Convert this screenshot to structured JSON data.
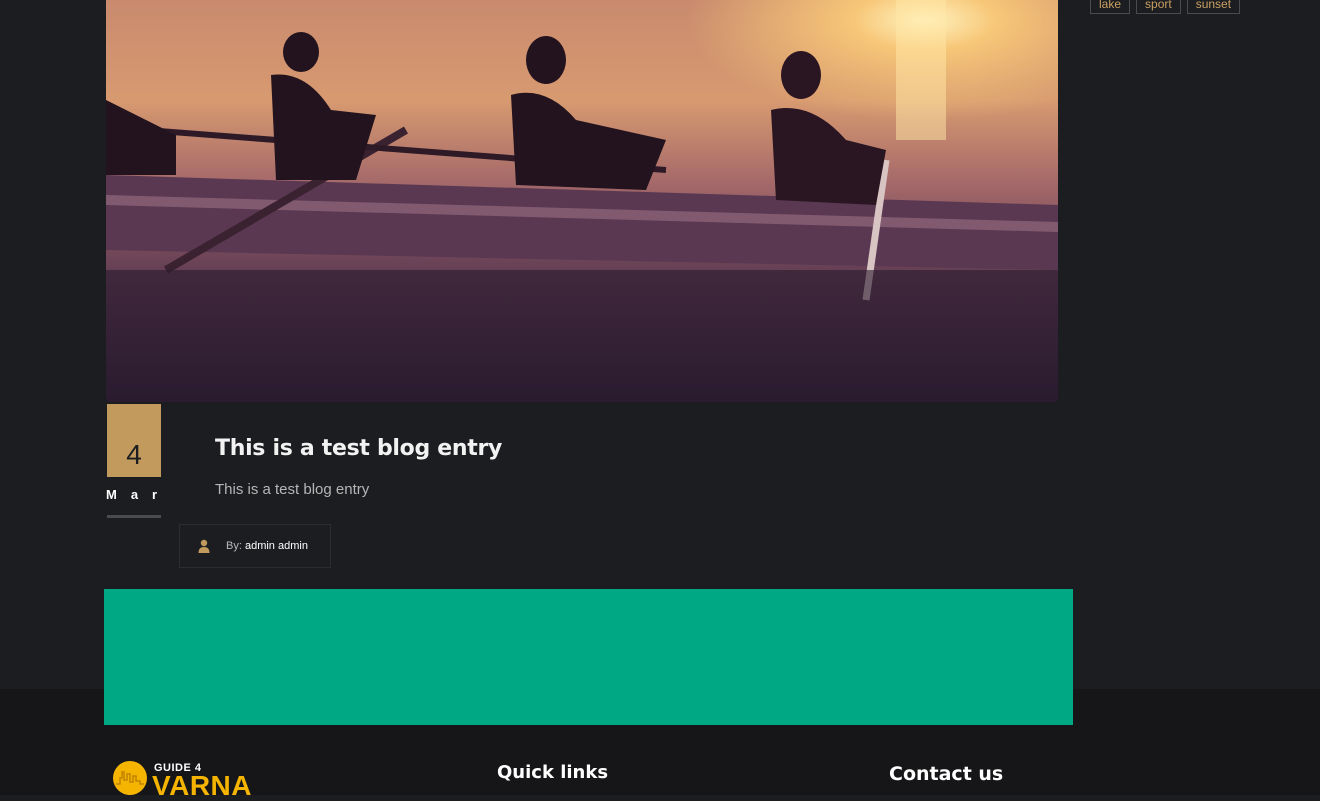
{
  "hero": {
    "alt": "Rowers on a lake at sunset"
  },
  "tags": [
    "lake",
    "sport",
    "sunset"
  ],
  "post": {
    "day": "4",
    "month": "Mar",
    "title": "This is a test blog entry",
    "excerpt": "This is a test blog entry",
    "author_prefix": "By:",
    "author_name": "admin admin"
  },
  "footer": {
    "logo_top": "GUIDE 4",
    "logo_main": "VARNA",
    "quick_links_heading": "Quick links",
    "contact_heading": "Contact us"
  },
  "colors": {
    "accent": "#c39a5d",
    "banner_green": "#00a984",
    "logo_yellow": "#f5b400",
    "background": "#1c1d20"
  },
  "icons": {
    "author": "user-icon",
    "logo": "city-skyline-icon"
  }
}
